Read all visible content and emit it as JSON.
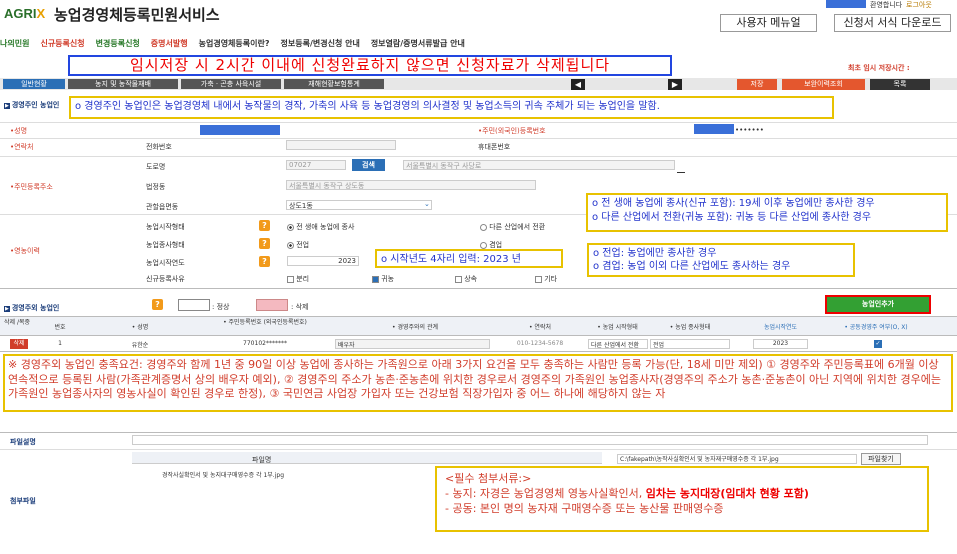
{
  "header": {
    "logo_agri": "AGRI",
    "logo_x": "X",
    "title": "농업경영체등록민원서비스",
    "welcome": "환영합니다",
    "logout": "로그아웃",
    "user_menu": "사용자 메뉴얼",
    "form_download": "신청서 서식 다운로드"
  },
  "nav": [
    "나의민원",
    "신규등록신청",
    "변경등록신청",
    "증명서발행",
    "농업경영체등록이란?",
    "정보등록/변경신청 안내",
    "정보열람/증명서류발급 안내"
  ],
  "banner": "임시저장 시 2시간 이내에 신청완료하지 않으면 신청자료가 삭제됩니다",
  "autosave": "최초 임시 저장시간 :",
  "tabs": [
    "일반현황",
    "농지 및 농작물재배",
    "가축 · 곤충 사육시설",
    "재해현황보험통계"
  ],
  "actions": {
    "save": "저장",
    "view": "보완이력조회",
    "list": "목록"
  },
  "owner_section": {
    "title": "경영주인 농업인",
    "info": "o 경영주인 농업인은 농업경영체 내에서 농작물의 경작, 가축의 사육 등 농업경영의 의사결정 및 농업소득의 귀속 주체가 되는 농업인을 말함."
  },
  "form": {
    "name_label": "•성명",
    "rrn_label": "•주민(외국인)등록번호",
    "rrn_suffix": "•••••••",
    "contact_label": "•연락처",
    "phone_label": "전화번호",
    "mobile_label": "휴대폰번호",
    "address_label": "•주민등록주소",
    "road_label": "도로명",
    "zip": "07027",
    "search": "검색",
    "road_value": "서울특별시 동작구 사당로",
    "lot_label": "법정동",
    "lot_value": "서울특별시 동작구 상도동",
    "admin_label": "관할읍면동",
    "admin_value": "상도1동",
    "career_label": "•영농이력",
    "type_label": "농업시작형태",
    "type_opt1": "전 생애 농업에 종사",
    "type_opt2": "다른 산업에서 전환",
    "fulltime_label": "농업종사형태",
    "fulltime_opt1": "전업",
    "fulltime_opt2": "겸업",
    "startyear_label": "농업시작연도",
    "startyear_value": "2023",
    "reason_label": "신규등록사유",
    "reason_opts": [
      "분리",
      "귀농",
      "상속",
      "기타"
    ]
  },
  "tips": {
    "career": [
      "o 전 생애 농업에 종사(신규 포함): 19세 이후 농업에만 종사한 경우",
      "o 다른 산업에서 전환(귀농 포함): 귀농 등 다른 산업에 종사한 경우"
    ],
    "startyear": "o 시작년도 4자리 입력: 2023 년",
    "fulltime": [
      "o 전업: 농업에만 종사한 경우",
      "o 겸업: 농업 이외 다른 산업에도 종사하는 경우"
    ]
  },
  "other_section": {
    "title": "경영주외 농업인",
    "legend_normal": ": 정상",
    "legend_delete": ": 삭제",
    "add_btn": "농업인추가"
  },
  "table": {
    "headers": [
      "삭제\n/복중",
      "번호",
      "• 성명",
      "• 주민등록번호\n(외국인등록번호)",
      "• 경영주와의 관계",
      "• 연락처",
      "• 농업 시작형태",
      "• 농업 종사형태",
      "농업시작연도",
      "• 공동경영주 여부(O, X)"
    ],
    "row": [
      "삭제",
      "1",
      "유한순",
      "770102*******",
      "배우자",
      "010-1234-5678",
      "다른 산업에서 전환",
      "전업",
      "2023",
      ""
    ]
  },
  "requirements": "※ 경영주외 농업인 충족요건: 경영주와 함께 1년 중 90일 이상 농업에 종사하는 가족원으로 아래 3가지 요건을 모두 충족하는 사람만 등록 가능(단, 18세 미만 제외) ① 경영주와 주민등록표에 6개월 이상 연속적으로 등록된 사람(가족관계증명서 상의 배우자 예외), ② 경영주의 주소가 농촌·준농촌에 위치한 경우로서 경영주의 가족원인 농업종사자(경영주의 주소가 농촌·준농촌이 아닌 지역에 위치한 경우에는 가족원인 농업종사자의 영농사실이 확인된 경우로 한정), ③ 국민연금 사업장 가입자 또는 건강보험 직장가입자 중 어느 하나에 해당하지 않는 자",
  "attach": {
    "desc_label": "파일설명",
    "attach_label": "첨부파일",
    "filename_header": "파일명",
    "file1": "경작사실확인서 및 농지대구매영수증 각 1부.jpg",
    "path": "C:\\fakepath\\농작사실확인서 및 농자재구매영수증 각 1부.jpg",
    "find": "파일찾기"
  },
  "docs": {
    "title": "<필수 첨부서류:>",
    "line1a": "- 농지: 자경은 농업경영체 영농사실확인서, ",
    "line1b": "임차는 농지대장(임대차 현황 포함)",
    "line2": "- 공동: 본인 명의 농자재 구매영수증 또는 농산물 판매영수증"
  },
  "colors": {
    "accent": "#d13d2b",
    "blue": "#2b6fb6",
    "green": "#33a033"
  }
}
